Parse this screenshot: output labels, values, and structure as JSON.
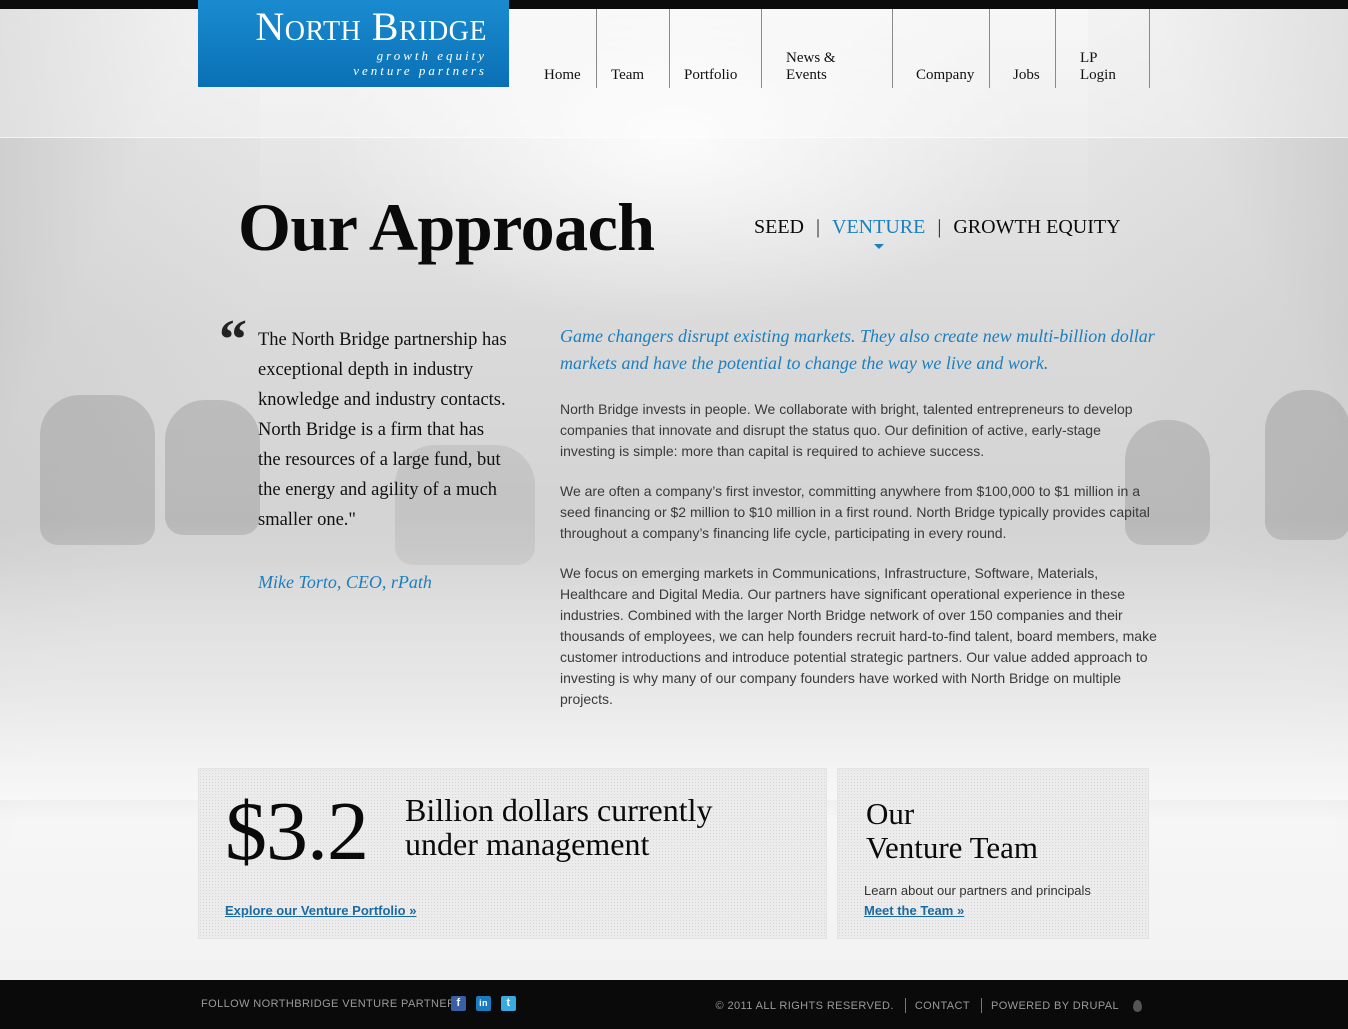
{
  "header": {
    "logo": {
      "name": "North Bridge",
      "tagline_line1": "growth equity",
      "tagline_line2": "venture partners"
    },
    "nav": [
      {
        "label": "Home"
      },
      {
        "label": "Team"
      },
      {
        "label": "Portfolio"
      },
      {
        "label": "News & Events"
      },
      {
        "label": "Company"
      },
      {
        "label": "Jobs"
      },
      {
        "label": "LP Login"
      }
    ]
  },
  "main": {
    "title": "Our Approach",
    "approach_tabs": [
      {
        "label": "SEED",
        "active": false
      },
      {
        "label": "VENTURE",
        "active": true
      },
      {
        "label": "GROWTH EQUITY",
        "active": false
      }
    ],
    "quote": {
      "mark": "“",
      "text": "The North Bridge partnership has exceptional depth in industry knowledge and industry contacts. North Bridge is a firm that has the resources of a large fund, but the energy and agility of a much smaller one.\"",
      "author": "Mike Torto, CEO, rPath"
    },
    "lead": "Game changers disrupt existing markets. They also create new multi-billion dollar markets and have the potential to change the way we live and work.",
    "paragraphs": [
      "North Bridge invests in people. We collaborate with bright, talented entrepreneurs to develop companies that innovate and disrupt the status quo. Our definition of active, early-stage investing is simple: more than capital is required to achieve success.",
      "We are often a company’s first investor, committing anywhere from $100,000 to $1 million in a seed financing or $2 million to $10 million in a first round. North Bridge typically provides capital throughout a company’s financing life cycle, participating in every round.",
      "We focus on emerging markets in Communications, Infrastructure, Software, Materials, Healthcare and Digital Media. Our partners have significant operational experience in these industries. Combined with the larger North Bridge network of over 150 companies and their thousands of employees, we can help founders recruit hard-to-find talent, board members, make customer introductions and introduce potential strategic partners. Our value added approach to investing is why many of our company founders have worked with North Bridge on multiple projects."
    ]
  },
  "promo": {
    "aum": {
      "number": "$3.2",
      "caption": "Billion dollars currently under management",
      "link": "Explore our Venture Portfolio »"
    },
    "team": {
      "title_line1": "Our",
      "title_line2": "Venture Team",
      "text": "Learn about our partners and principals",
      "link": "Meet the Team »"
    }
  },
  "footer": {
    "follow": "FOLLOW NORTHBRIDGE VENTURE PARTNERS",
    "social": [
      {
        "icon": "facebook-icon",
        "glyph": "f"
      },
      {
        "icon": "linkedin-icon",
        "glyph": "in"
      },
      {
        "icon": "twitter-icon",
        "glyph": "t"
      }
    ],
    "copyright": "© 2011 ALL RIGHTS RESERVED.",
    "contact": "CONTACT",
    "powered": "POWERED BY DRUPAL"
  },
  "colors": {
    "accent": "#1c7fbf",
    "logo_bg": "#0a70b5",
    "footer_bg": "#0a0a0a"
  }
}
